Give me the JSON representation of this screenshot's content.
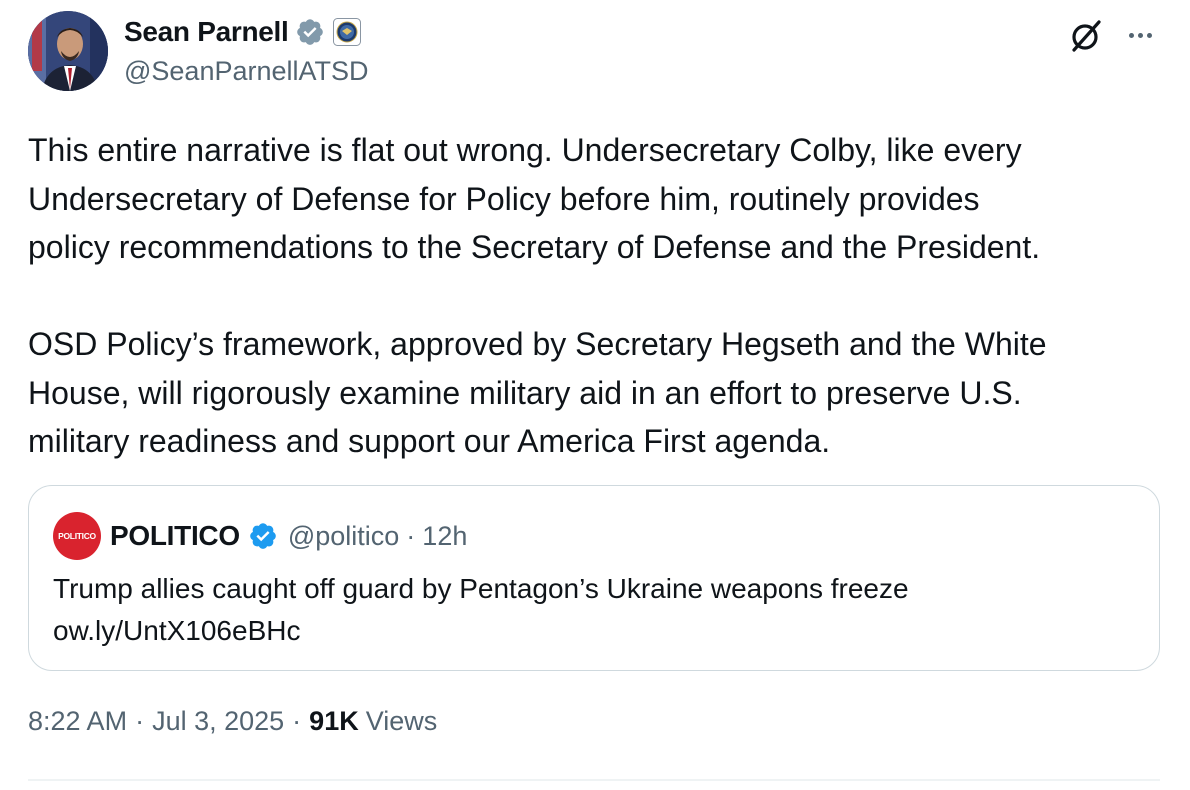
{
  "author": {
    "display_name": "Sean Parnell",
    "handle": "@SeanParnellATSD",
    "verified_badge_color": "#829aab",
    "affiliation_icon": "dod-seal-icon"
  },
  "toolbar": {
    "grok_icon": "grok-icon",
    "more_icon": "more-options-icon"
  },
  "tweet": {
    "paragraph1": [
      "This entire narrative is flat out wrong. Undersecretary Colby, like every",
      "Undersecretary of Defense for Policy before him, routinely provides",
      "policy recommendations to the Secretary of Defense and the President."
    ],
    "paragraph2": [
      "OSD Policy’s framework, approved by Secretary Hegseth and the White",
      "House, will rigorously examine military aid in an effort to preserve U.S.",
      "military readiness and support our America First agenda."
    ]
  },
  "quoted": {
    "avatar_text": "POLITICO",
    "avatar_color": "#d9232e",
    "display_name": "POLITICO",
    "verified_badge_color": "#1d9bf0",
    "handle": "@politico",
    "separator": "·",
    "time": "12h",
    "text_line1": "Trump allies caught off guard by Pentagon’s Ukraine weapons freeze",
    "text_line2": "ow.ly/UntX106eBHc"
  },
  "meta": {
    "time": "8:22 AM",
    "separator": "·",
    "date": "Jul 3, 2025",
    "views_count": "91K",
    "views_label": "Views"
  },
  "colors": {
    "text_primary": "#0f1419",
    "text_secondary": "#536471",
    "border": "#cfd9de"
  }
}
